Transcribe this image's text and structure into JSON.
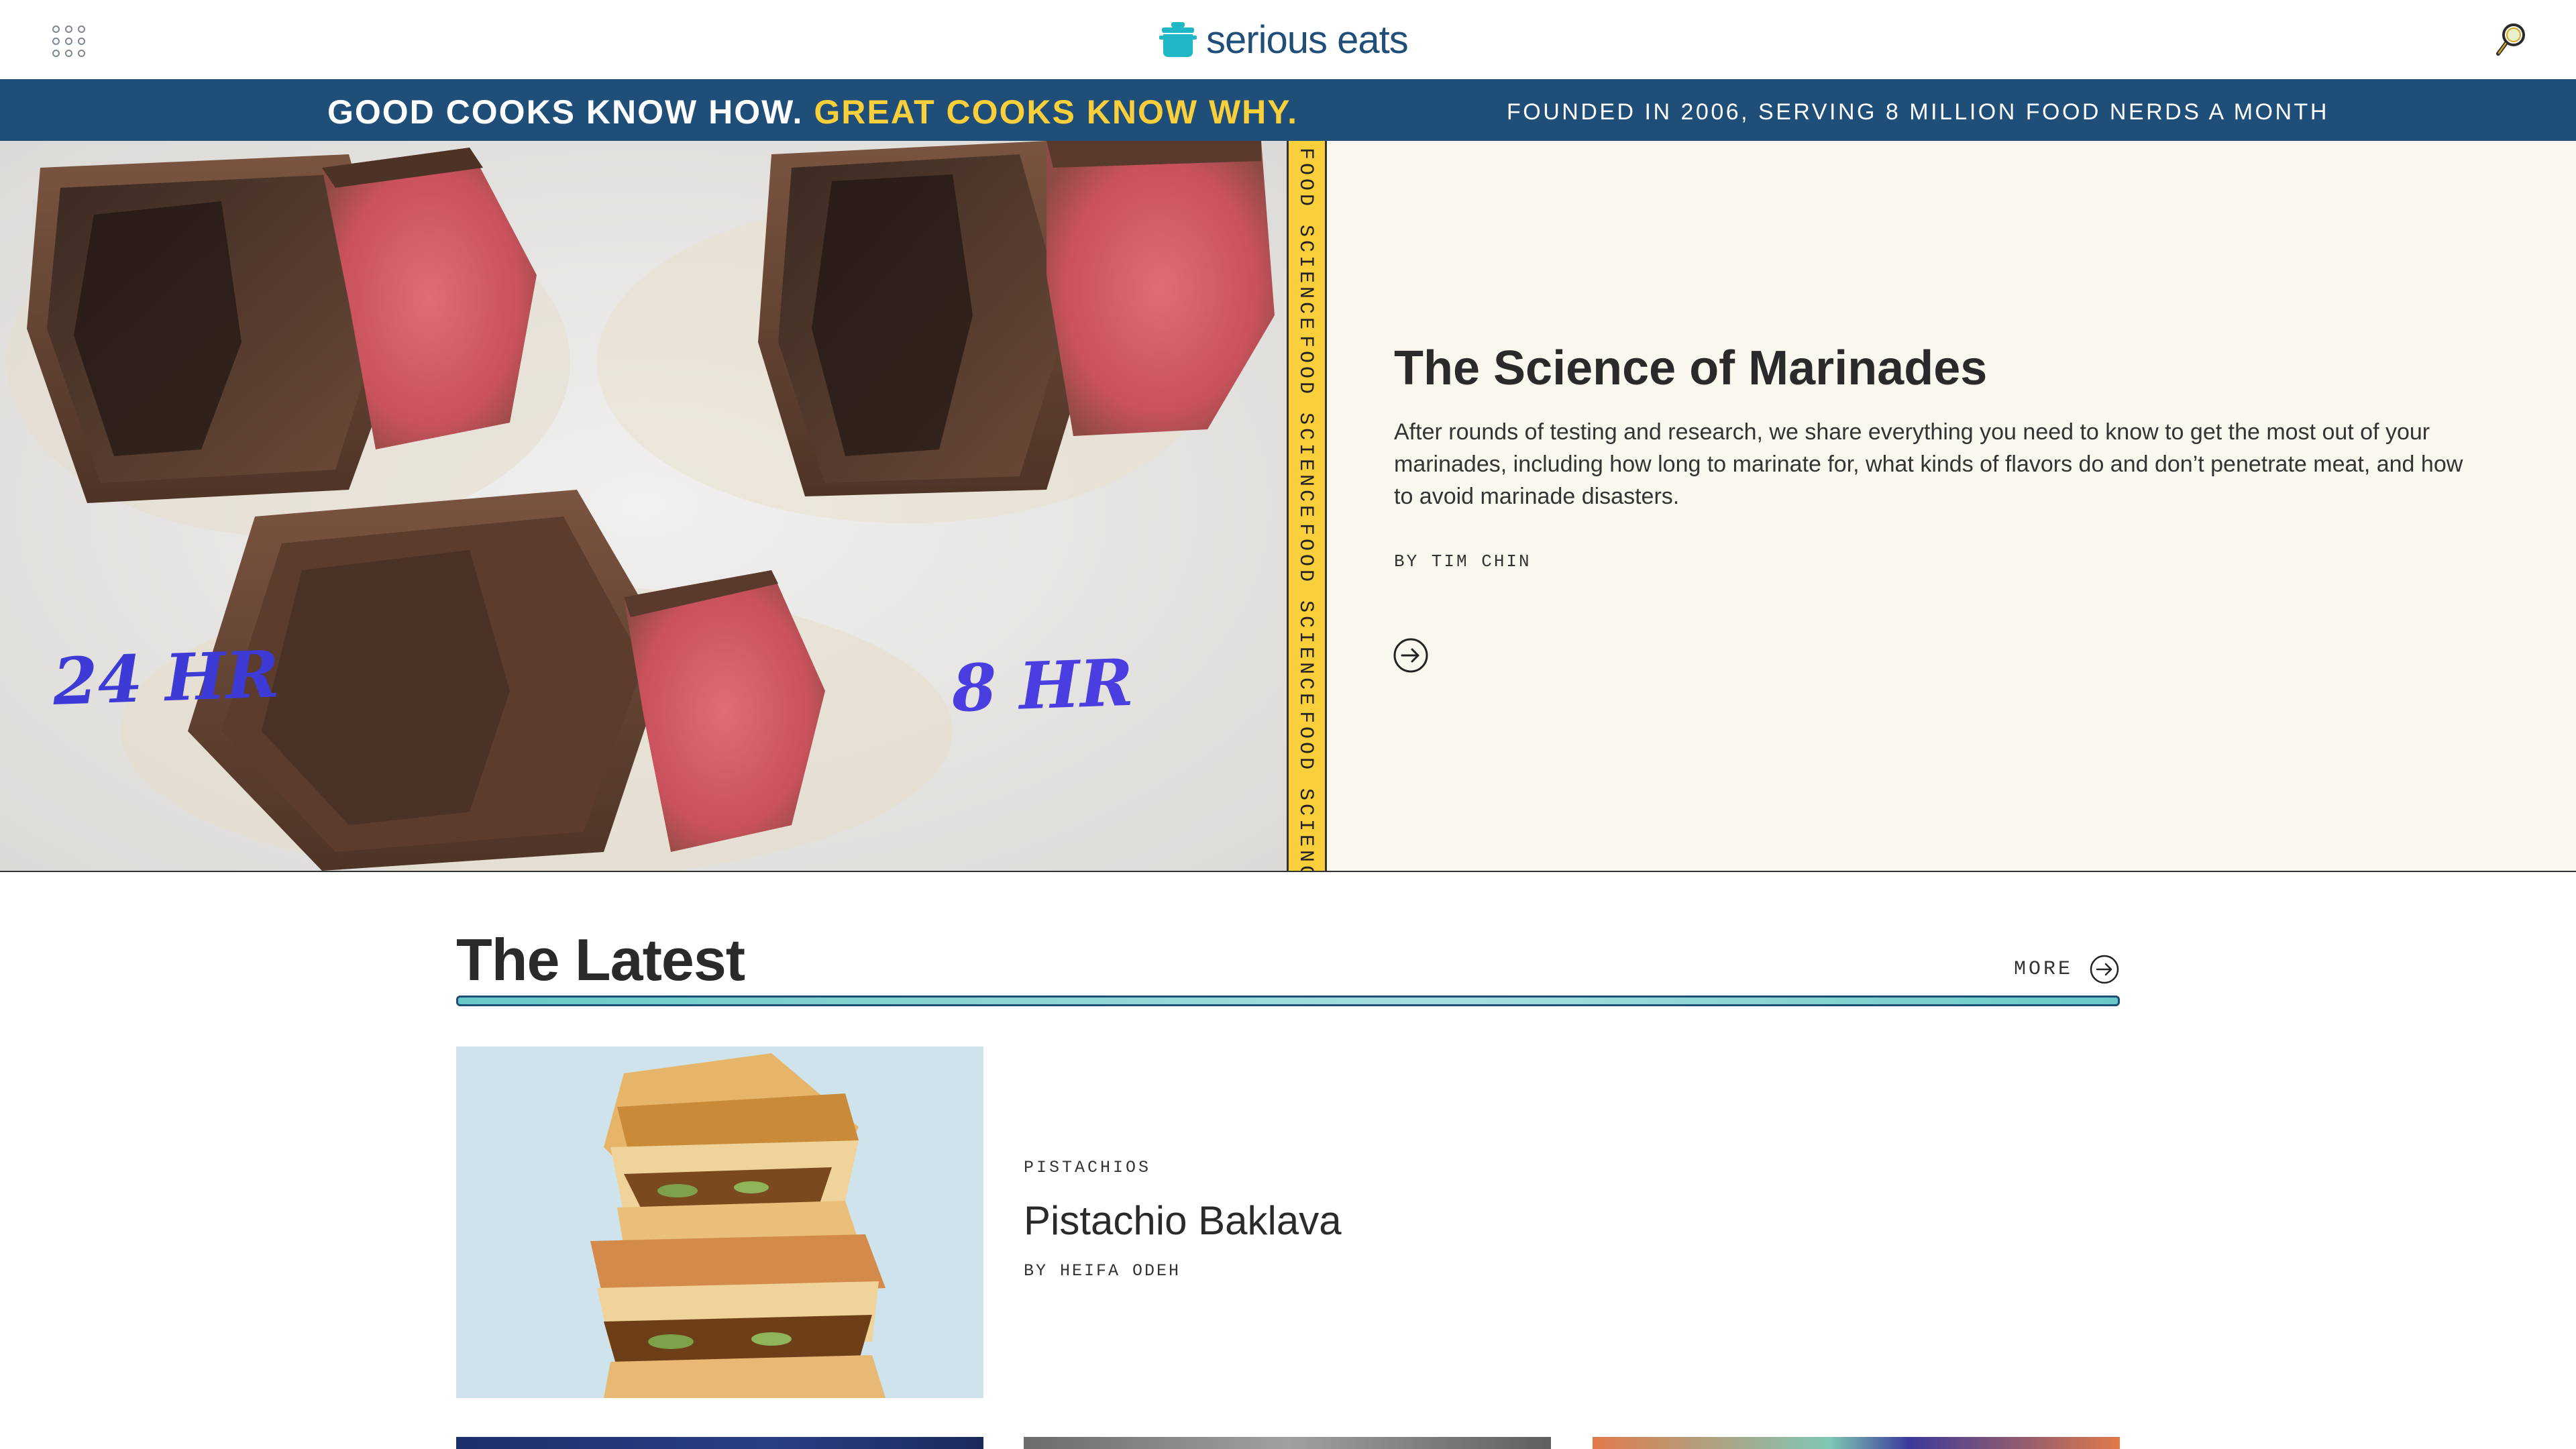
{
  "header": {
    "menu_icon": "grid-menu-icon",
    "logo_text": "serious eats",
    "logo_icon": "pot-icon",
    "search_icon": "search-icon",
    "colors": {
      "brand": "#1f4e79",
      "pot": "#1fb7c5",
      "search": "#d9a41f"
    }
  },
  "banner": {
    "tagline_part1": "GOOD COOKS KNOW HOW.",
    "tagline_part2": "GREAT COOKS KNOW WHY.",
    "founded": "FOUNDED IN 2006, SERVING 8 MILLION FOOD NERDS A MONTH",
    "colors": {
      "background": "#1f4e79",
      "accent": "#f9cf3b"
    }
  },
  "hero": {
    "category_label": "FOOD SCIENCE",
    "image_labels": [
      "24 HR",
      "8 HR"
    ],
    "title": "The Science of Marinades",
    "description": "After rounds of testing and research, we share everything you need to know to get the most out of your marinades, including how long to marinate for, what kinds of flavors do and don’t penetrate meat, and how to avoid marinade disasters.",
    "byline": "BY TIM CHIN",
    "arrow_icon": "arrow-right-circle-icon",
    "colors": {
      "strip": "#f9cf3b",
      "card_background": "#f9f7ee"
    }
  },
  "latest": {
    "title": "The Latest",
    "more_label": "MORE",
    "more_icon": "arrow-right-circle-icon",
    "featured": {
      "tag": "PISTACHIOS",
      "title": "Pistachio Baklava",
      "byline": "BY HEIFA ODEH"
    }
  }
}
